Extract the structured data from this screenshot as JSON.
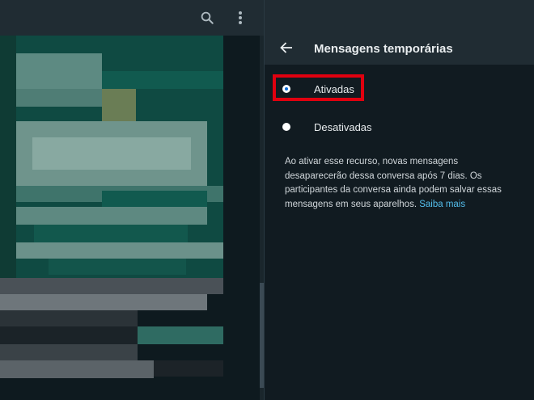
{
  "chat_header": {
    "search_icon": "search-icon",
    "menu_icon": "kebab-menu-icon"
  },
  "panel": {
    "back_icon": "arrow-left-icon",
    "title": "Mensagens temporárias",
    "options": [
      {
        "label": "Ativadas",
        "selected": true
      },
      {
        "label": "Desativadas",
        "selected": false
      }
    ],
    "description": "Ao ativar esse recurso, novas mensagens desaparecerão dessa conversa após 7 dias. Os participantes da conversa ainda podem salvar essas mensagens em seus aparelhos.",
    "learn_more": "Saiba mais"
  },
  "colors": {
    "panel_bg": "#111b21",
    "header_bg": "#202c33",
    "link": "#53bdeb",
    "highlight": "#e1000f",
    "radio_selected": "#0b6bd6"
  }
}
